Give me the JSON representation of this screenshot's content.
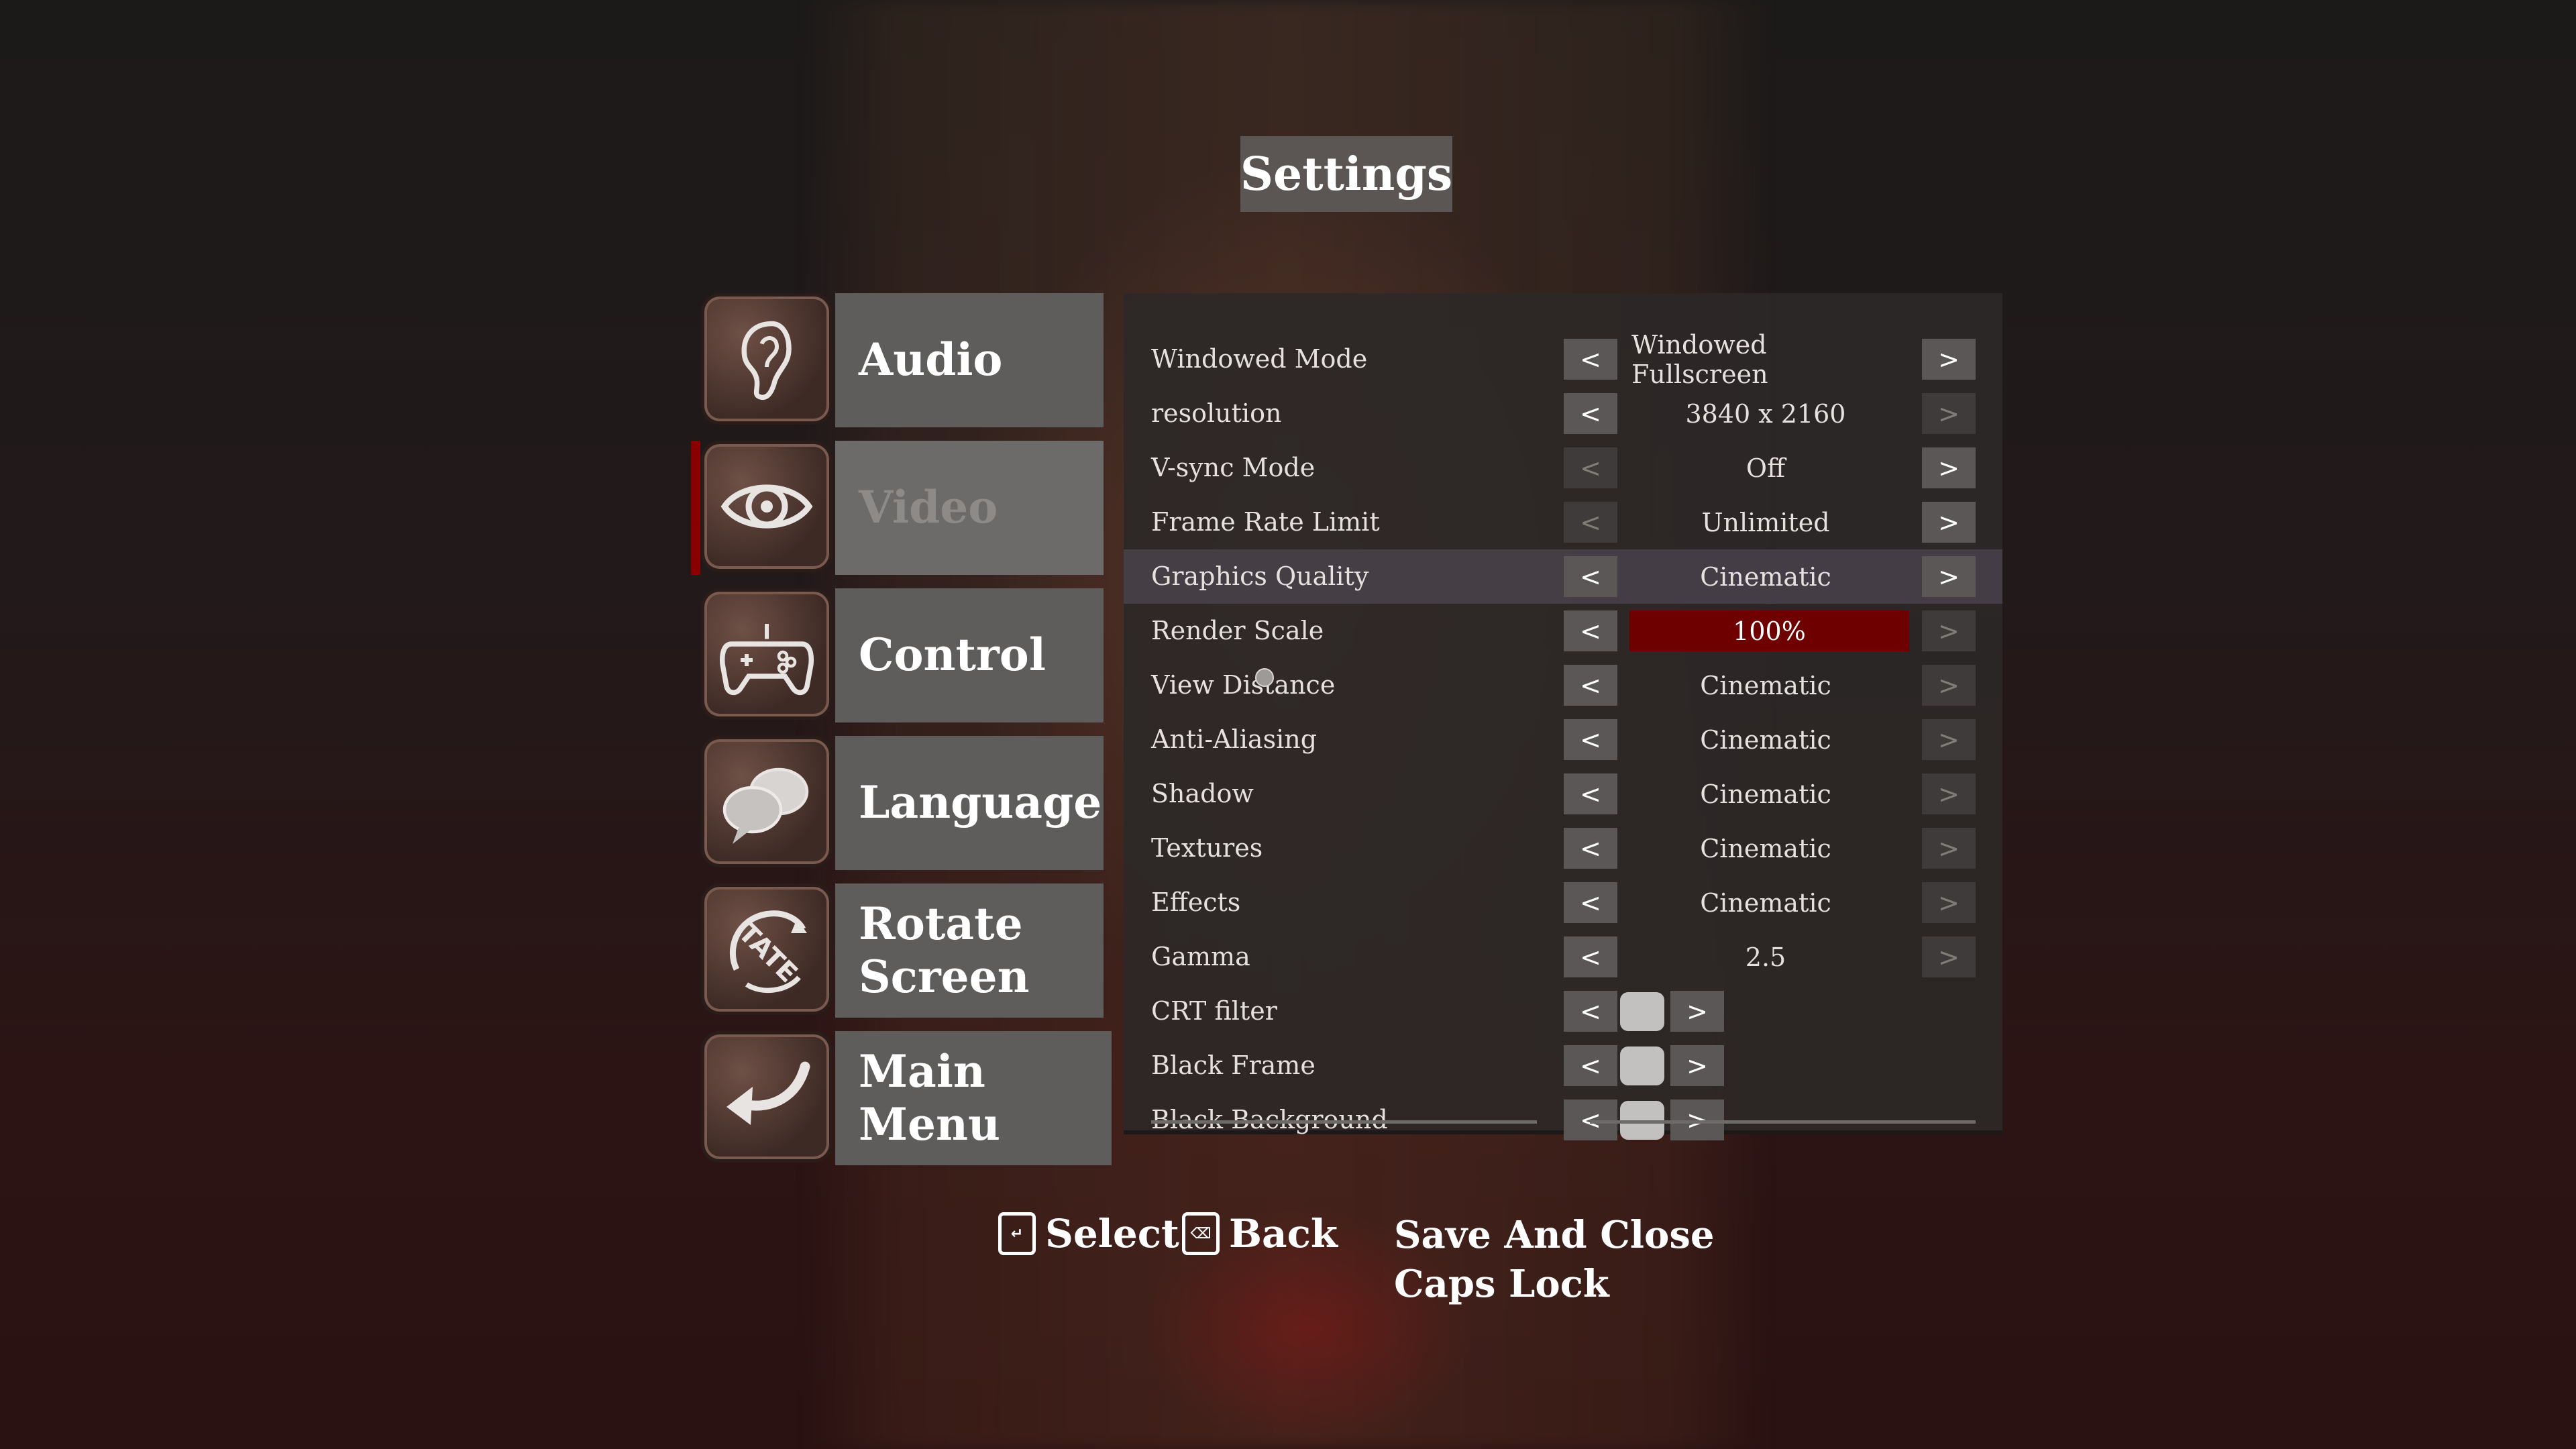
{
  "title": "Settings",
  "menu": [
    {
      "label": "Audio",
      "icon": "ear-icon"
    },
    {
      "label": "Video",
      "icon": "eye-icon",
      "active": true
    },
    {
      "label": "Control",
      "icon": "gamepad-icon"
    },
    {
      "label": "Language",
      "icon": "speech-bubbles-icon"
    },
    {
      "label": "Rotate Screen",
      "icon": "tate-rotate-icon"
    },
    {
      "label": "Main Menu",
      "icon": "back-arrow-icon"
    }
  ],
  "settings": [
    {
      "label": "Windowed Mode",
      "value": "Windowed Fullscreen",
      "left": "<",
      "right": ">"
    },
    {
      "label": "resolution",
      "value": "3840 x 2160",
      "left": "<",
      "right": ">"
    },
    {
      "label": "V-sync Mode",
      "value": "Off",
      "left": "<",
      "right": ">"
    },
    {
      "label": "Frame Rate Limit",
      "value": "Unlimited",
      "left": "<",
      "right": ">"
    },
    {
      "label": "Graphics Quality",
      "value": "Cinematic",
      "left": "<",
      "right": ">"
    },
    {
      "label": "Render Scale",
      "value": "100%",
      "left": "<",
      "right": ">"
    },
    {
      "label": "View Distance",
      "value": "Cinematic",
      "left": "<",
      "right": ">"
    },
    {
      "label": "Anti-Aliasing",
      "value": "Cinematic",
      "left": "<",
      "right": ">"
    },
    {
      "label": "Shadow",
      "value": "Cinematic",
      "left": "<",
      "right": ">"
    },
    {
      "label": "Textures",
      "value": "Cinematic",
      "left": "<",
      "right": ">"
    },
    {
      "label": "Effects",
      "value": "Cinematic",
      "left": "<",
      "right": ">"
    },
    {
      "label": "Gamma",
      "value": "2.5",
      "left": "<",
      "right": ">"
    },
    {
      "label": "CRT filter",
      "left": "<",
      "right": ">"
    },
    {
      "label": "Black Frame",
      "left": "<",
      "right": ">"
    },
    {
      "label": "Black Background",
      "left": "<",
      "right": ">"
    }
  ],
  "footer": {
    "select_label": "Select",
    "select_key": "↵",
    "back_label": "Back",
    "back_key": "⌫",
    "save_label": "Save And Close",
    "save_key": "Caps Lock"
  },
  "colors": {
    "accent_red": "#8a0000",
    "render_scale_bar": "#6f0000",
    "menu_button": "#5f5d5c",
    "panel": "#2d2827"
  }
}
